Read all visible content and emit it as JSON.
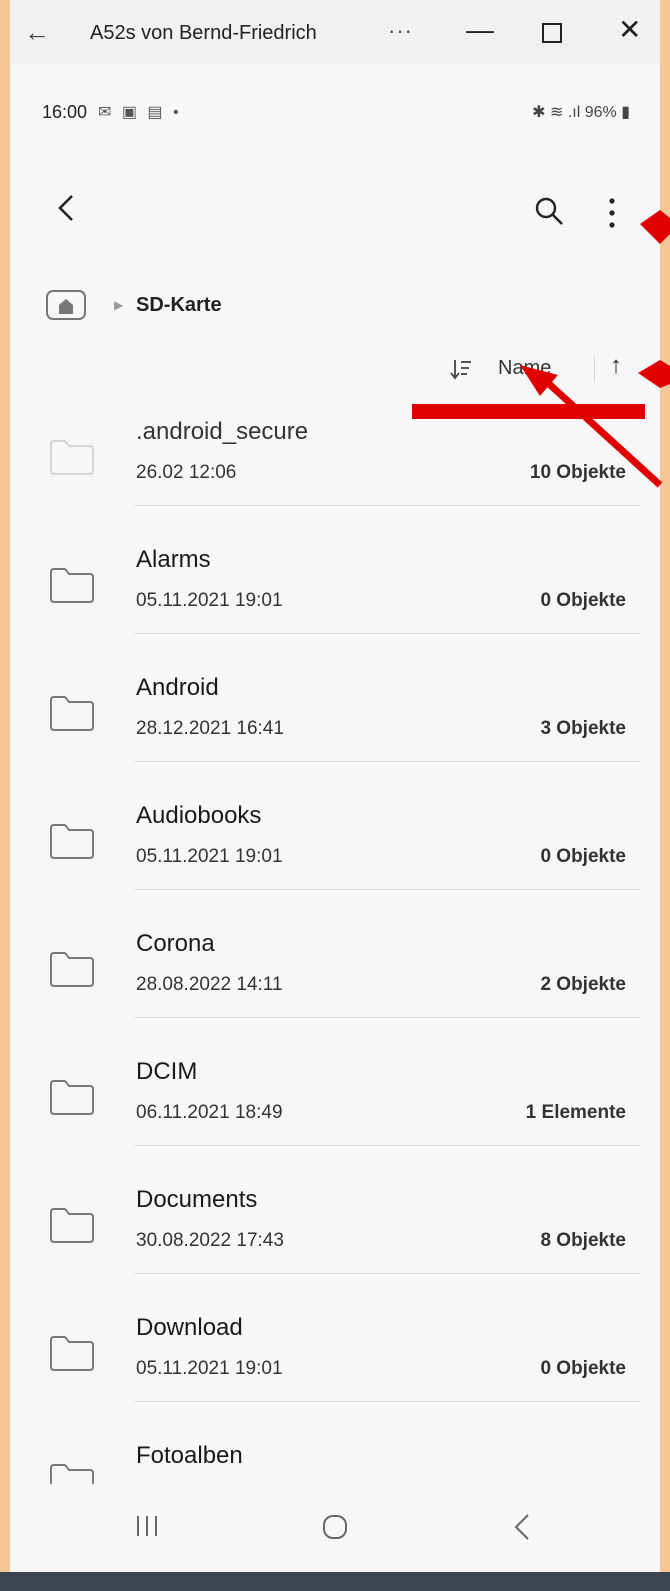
{
  "window": {
    "back_glyph": "←",
    "title": "A52s von Bernd-Friedrich",
    "more_glyph": "···",
    "minimize_glyph": "—",
    "close_glyph": "✕"
  },
  "statusbar": {
    "time": "16:00",
    "notifications": "✉ ▣ ▤ •",
    "system": "✱ ≋ .ıl 96% ▮"
  },
  "toolbar": {
    "back_icon": "chevron-left-icon",
    "search_icon": "search-icon",
    "more_icon": "more-vert-icon"
  },
  "breadcrumb": {
    "home_icon": "home-icon",
    "separator": "▶",
    "current": "SD-Karte"
  },
  "sort": {
    "icon": "sort-icon",
    "label": "Name",
    "direction_glyph": "↑"
  },
  "files": [
    {
      "name": ".android_secure",
      "date": "26.02 12:06",
      "count": "10 Objekte",
      "faded": true
    },
    {
      "name": "Alarms",
      "date": "05.11.2021 19:01",
      "count": "0 Objekte"
    },
    {
      "name": "Android",
      "date": "28.12.2021 16:41",
      "count": "3 Objekte"
    },
    {
      "name": "Audiobooks",
      "date": "05.11.2021 19:01",
      "count": "0 Objekte"
    },
    {
      "name": "Corona",
      "date": "28.08.2022 14:11",
      "count": "2 Objekte"
    },
    {
      "name": "DCIM",
      "date": "06.11.2021 18:49",
      "count": "1 Elemente"
    },
    {
      "name": "Documents",
      "date": "30.08.2022 17:43",
      "count": "8 Objekte"
    },
    {
      "name": "Download",
      "date": "05.11.2021 19:01",
      "count": "0 Objekte"
    },
    {
      "name": "Fotoalben",
      "date": "",
      "count": ""
    }
  ],
  "navbar": {
    "recent_icon": "recent-apps-icon",
    "home_icon": "home-button-icon",
    "back_icon": "back-icon"
  },
  "colors": {
    "page_background": "#f5c794",
    "app_background": "#f7f7f9",
    "annotation": "#e10000"
  }
}
